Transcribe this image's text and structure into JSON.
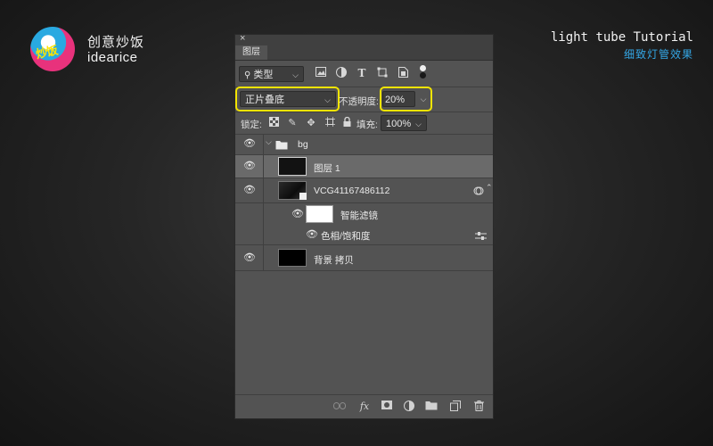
{
  "branding": {
    "badge_text": "炒饭",
    "name_cn": "创意炒饭",
    "name_en": "idearice",
    "tutorial_en": "light tube Tutorial",
    "tutorial_cn": "细致灯管效果"
  },
  "panel": {
    "close_glyph": "×",
    "tab_label": "图层",
    "filter_kind_label": "类型",
    "blend_mode": "正片叠底",
    "opacity_label": "不透明度:",
    "opacity_value": "20%",
    "lock_label": "锁定:",
    "fill_label": "填充:",
    "fill_value": "100%",
    "highlight_color": "#f2e400"
  },
  "layers": {
    "group": {
      "name": "bg"
    },
    "layer1": {
      "name": "图层 1"
    },
    "smart_object": {
      "name": "VCG41167486112"
    },
    "smart_filters": {
      "name": "智能滤镜"
    },
    "filter_hue": {
      "name": "色相/饱和度"
    },
    "copy_layer": {
      "name": "背景 拷贝"
    }
  },
  "bottom_bar": {
    "fx_label": "fx"
  }
}
